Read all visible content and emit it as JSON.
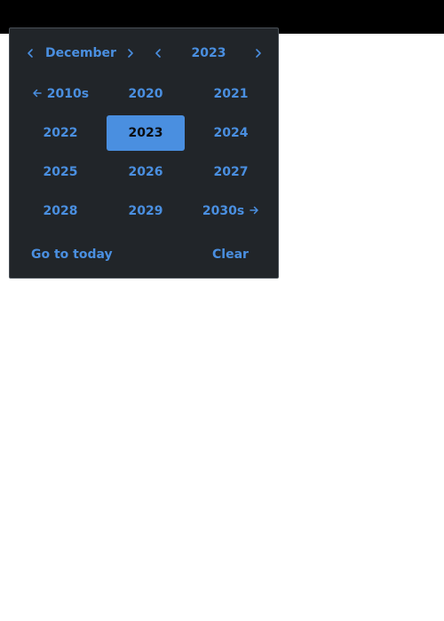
{
  "header": {
    "month": "December",
    "year": "2023"
  },
  "years": {
    "prev_decade": "2010s",
    "next_decade": "2030s",
    "items": [
      "2020",
      "2021",
      "2022",
      "2023",
      "2024",
      "2025",
      "2026",
      "2027",
      "2028",
      "2029"
    ],
    "selected": "2023"
  },
  "footer": {
    "today_label": "Go to today",
    "clear_label": "Clear"
  },
  "colors": {
    "background": "#212529",
    "accent": "#4a8fe0",
    "topbar": "#000000"
  }
}
